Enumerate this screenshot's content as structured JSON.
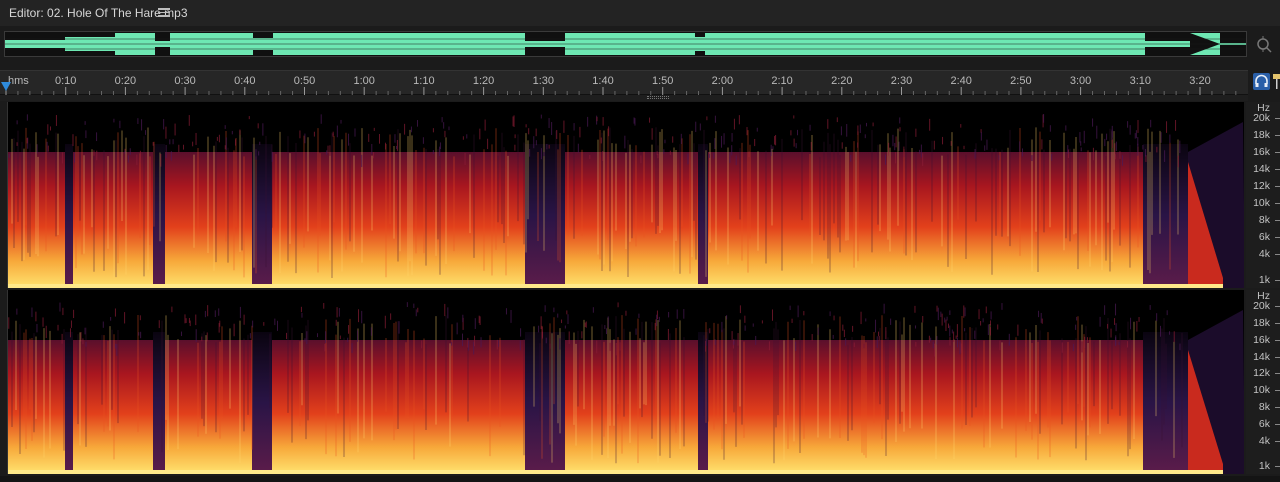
{
  "editor": {
    "title": "Editor: 02. Hole Of The Hare.mp3",
    "menu_icon": "hamburger-menu-icon",
    "zoom_icon": "zoom-navigator-icon"
  },
  "ruler": {
    "unit": "hms",
    "ticks": [
      "0:10",
      "0:20",
      "0:30",
      "0:40",
      "0:50",
      "1:00",
      "1:10",
      "1:20",
      "1:30",
      "1:40",
      "1:50",
      "2:00",
      "2:10",
      "2:20",
      "2:30",
      "2:40",
      "2:50",
      "3:00",
      "3:10",
      "3:20"
    ]
  },
  "tools": {
    "monitor_icon": "headphone-monitor-icon",
    "pin_icon": "pin-icon"
  },
  "spectrogram": {
    "unit_label": "Hz",
    "freq_labels": [
      "20k",
      "18k",
      "16k",
      "14k",
      "12k",
      "10k",
      "8k",
      "6k",
      "4k",
      "1k"
    ],
    "channels": [
      "left",
      "right"
    ]
  },
  "colors": {
    "waveform": "#6ee8b3",
    "playhead": "#2f8bdb",
    "spectrum_low": "#000000",
    "spectrum_mid": "#b21d1f",
    "spectrum_high": "#ffe067"
  }
}
